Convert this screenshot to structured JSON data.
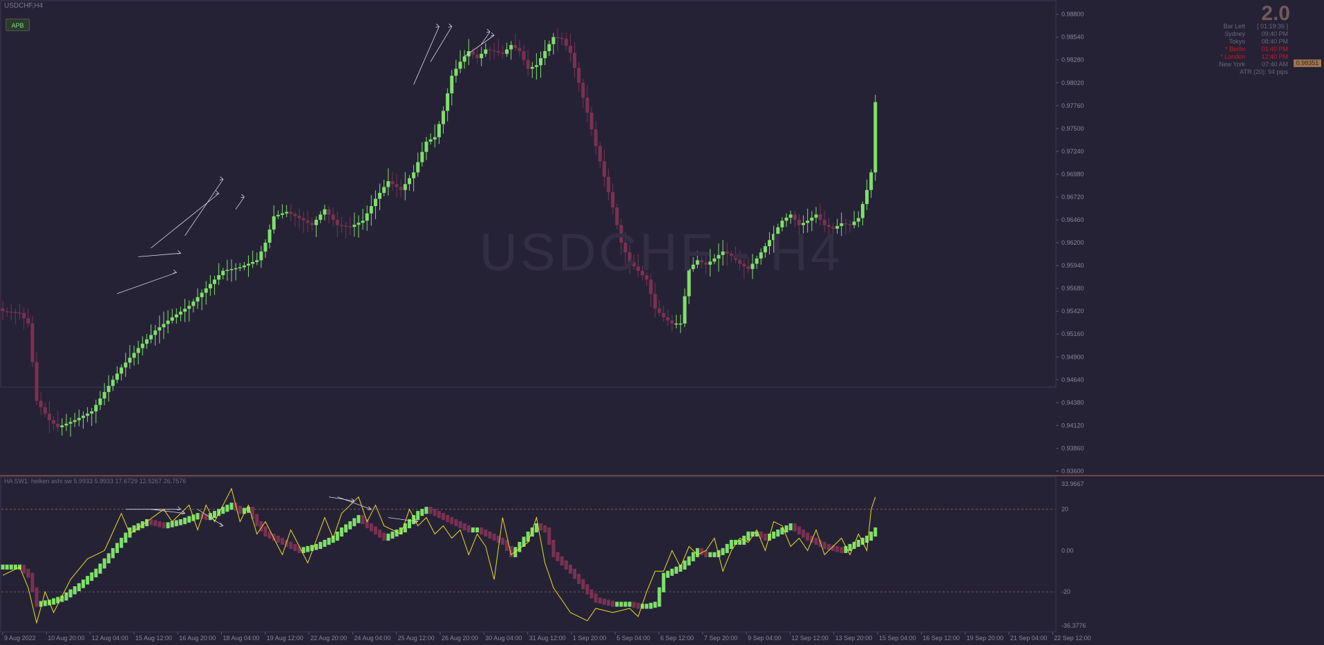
{
  "window": {
    "symbol": "USDCHF,H4",
    "watermark": "USDCHF - H4"
  },
  "toolbar": {
    "apb_label": "APB"
  },
  "version": "2.0",
  "sessions": [
    {
      "label": "Bar Left",
      "value": "[ 01:19:36 ]",
      "active": false
    },
    {
      "label": "Sydney",
      "value": "09:40 PM",
      "active": false
    },
    {
      "label": "Tokyo",
      "value": "08:40 PM",
      "active": false
    },
    {
      "label": "* Berlin",
      "value": "01:40 PM",
      "active": true
    },
    {
      "label": "* London",
      "value": "12:40 PM",
      "active": true
    },
    {
      "label": "New York",
      "value": "07:40 AM",
      "active": false
    }
  ],
  "atr_text": "ATR (20): 94 pips",
  "current_price": "0.98351",
  "colors": {
    "background": "#262236",
    "bull": "#7ee06a",
    "bear": "#7a3152",
    "oscillator_line": "#e8e020",
    "divergence": "#d8d8e8"
  },
  "indicator_label": "HA SW1: heiken ashi sw 5.9933 5.9933 17.6729 12.5267 26.7576",
  "chart_data": [
    {
      "type": "candlestick",
      "title": "USDCHF,H4",
      "y_ticks": [
        "0.98800",
        "0.98540",
        "0.98280",
        "0.98020",
        "0.97760",
        "0.97500",
        "0.97240",
        "0.96980",
        "0.96720",
        "0.96460",
        "0.96200",
        "0.95940",
        "0.95680",
        "0.95420",
        "0.95160",
        "0.94900",
        "0.94640",
        "0.94380",
        "0.94120",
        "0.93860",
        "0.93600"
      ],
      "ylim": [
        0.9358,
        0.9886
      ],
      "x_ticks": [
        "9 Aug 2022",
        "10 Aug 20:00",
        "12 Aug 04:00",
        "15 Aug 12:00",
        "16 Aug 20:00",
        "18 Aug 04:00",
        "19 Aug 12:00",
        "22 Aug 20:00",
        "24 Aug 04:00",
        "25 Aug 12:00",
        "26 Aug 20:00",
        "30 Aug 04:00",
        "31 Aug 12:00",
        "1 Sep 20:00",
        "5 Sep 04:00",
        "6 Sep 12:00",
        "7 Sep 20:00",
        "9 Sep 04:00",
        "12 Sep 12:00",
        "13 Sep 20:00",
        "15 Sep 04:00",
        "16 Sep 12:00",
        "19 Sep 20:00",
        "21 Sep 04:00",
        "22 Sep 12:00"
      ],
      "close_anchors": [
        [
          0,
          0.9542
        ],
        [
          4,
          0.954
        ],
        [
          6,
          0.9528
        ],
        [
          8,
          0.944
        ],
        [
          11,
          0.9418
        ],
        [
          13,
          0.941
        ],
        [
          17,
          0.9418
        ],
        [
          21,
          0.9428
        ],
        [
          24,
          0.945
        ],
        [
          28,
          0.9478
        ],
        [
          32,
          0.95
        ],
        [
          36,
          0.952
        ],
        [
          40,
          0.9535
        ],
        [
          44,
          0.9548
        ],
        [
          48,
          0.9568
        ],
        [
          52,
          0.9588
        ],
        [
          56,
          0.9592
        ],
        [
          60,
          0.96
        ],
        [
          62,
          0.962
        ],
        [
          64,
          0.965
        ],
        [
          67,
          0.9655
        ],
        [
          70,
          0.9648
        ],
        [
          73,
          0.964
        ],
        [
          76,
          0.9658
        ],
        [
          79,
          0.964
        ],
        [
          82,
          0.9638
        ],
        [
          85,
          0.9645
        ],
        [
          88,
          0.967
        ],
        [
          91,
          0.969
        ],
        [
          94,
          0.968
        ],
        [
          97,
          0.97
        ],
        [
          100,
          0.9735
        ],
        [
          102,
          0.974
        ],
        [
          104,
          0.977
        ],
        [
          106,
          0.981
        ],
        [
          108,
          0.9826
        ],
        [
          110,
          0.9838
        ],
        [
          112,
          0.983
        ],
        [
          114,
          0.984
        ],
        [
          116,
          0.9838
        ],
        [
          118,
          0.9835
        ],
        [
          120,
          0.9845
        ],
        [
          122,
          0.9838
        ],
        [
          124,
          0.9818
        ],
        [
          126,
          0.9822
        ],
        [
          128,
          0.9838
        ],
        [
          130,
          0.9854
        ],
        [
          132,
          0.9852
        ],
        [
          134,
          0.9836
        ],
        [
          136,
          0.9802
        ],
        [
          138,
          0.9768
        ],
        [
          140,
          0.973
        ],
        [
          142,
          0.9695
        ],
        [
          144,
          0.966
        ],
        [
          146,
          0.962
        ],
        [
          148,
          0.9598
        ],
        [
          150,
          0.9588
        ],
        [
          152,
          0.9578
        ],
        [
          154,
          0.9545
        ],
        [
          156,
          0.9535
        ],
        [
          158,
          0.9528
        ],
        [
          160,
          0.9528
        ],
        [
          162,
          0.959
        ],
        [
          164,
          0.96
        ],
        [
          166,
          0.9595
        ],
        [
          168,
          0.9602
        ],
        [
          170,
          0.961
        ],
        [
          172,
          0.9605
        ],
        [
          174,
          0.9596
        ],
        [
          176,
          0.959
        ],
        [
          178,
          0.9602
        ],
        [
          180,
          0.9616
        ],
        [
          182,
          0.963
        ],
        [
          184,
          0.9645
        ],
        [
          186,
          0.9652
        ],
        [
          188,
          0.964
        ],
        [
          190,
          0.9645
        ],
        [
          192,
          0.9652
        ],
        [
          194,
          0.964
        ],
        [
          196,
          0.9636
        ],
        [
          198,
          0.9642
        ],
        [
          200,
          0.964
        ],
        [
          202,
          0.9648
        ],
        [
          204,
          0.968
        ],
        [
          205,
          0.97
        ],
        [
          206,
          0.978
        ]
      ],
      "divergence_lines": [
        [
          27,
          0.9562,
          41,
          0.9586
        ],
        [
          32,
          0.9604,
          42,
          0.9608
        ],
        [
          35,
          0.9614,
          51,
          0.9676
        ],
        [
          43,
          0.9628,
          52,
          0.9692
        ],
        [
          55,
          0.9658,
          57,
          0.9672
        ],
        [
          97,
          0.98,
          103,
          0.9866
        ],
        [
          101,
          0.9826,
          106,
          0.9866
        ],
        [
          109,
          0.9832,
          116,
          0.9856
        ],
        [
          113,
          0.9846,
          115,
          0.986
        ]
      ]
    },
    {
      "type": "oscillator",
      "title": "HA SW1: heiken ashi sw 5.9933 5.9933 17.6729 12.5267 26.7576",
      "y_ticks": [
        "33.9667",
        "20",
        "0.00",
        "-20",
        "-36.3776"
      ],
      "ylim": [
        -36.3776,
        33.9667
      ],
      "levels": [
        20,
        -20
      ],
      "value_anchors": [
        [
          0,
          -8
        ],
        [
          4,
          -8
        ],
        [
          6,
          -12
        ],
        [
          8,
          -26
        ],
        [
          11,
          -25
        ],
        [
          14,
          -23
        ],
        [
          18,
          -17
        ],
        [
          22,
          -10
        ],
        [
          26,
          0
        ],
        [
          30,
          10
        ],
        [
          34,
          14
        ],
        [
          38,
          12
        ],
        [
          42,
          14
        ],
        [
          46,
          17
        ],
        [
          48,
          16
        ],
        [
          50,
          18
        ],
        [
          54,
          22
        ],
        [
          56,
          19
        ],
        [
          58,
          20
        ],
        [
          60,
          13
        ],
        [
          62,
          8
        ],
        [
          66,
          4
        ],
        [
          70,
          0
        ],
        [
          74,
          2
        ],
        [
          78,
          6
        ],
        [
          80,
          10
        ],
        [
          84,
          16
        ],
        [
          86,
          12
        ],
        [
          90,
          6
        ],
        [
          94,
          10
        ],
        [
          96,
          14
        ],
        [
          98,
          18
        ],
        [
          100,
          20
        ],
        [
          102,
          18
        ],
        [
          104,
          16
        ],
        [
          106,
          14
        ],
        [
          108,
          12
        ],
        [
          110,
          10
        ],
        [
          112,
          10
        ],
        [
          114,
          8
        ],
        [
          116,
          6
        ],
        [
          118,
          4
        ],
        [
          120,
          -2
        ],
        [
          124,
          8
        ],
        [
          126,
          12
        ],
        [
          128,
          10
        ],
        [
          130,
          -2
        ],
        [
          134,
          -10
        ],
        [
          138,
          -20
        ],
        [
          140,
          -24
        ],
        [
          144,
          -26
        ],
        [
          148,
          -26
        ],
        [
          150,
          -27
        ],
        [
          152,
          -27
        ],
        [
          154,
          -26
        ],
        [
          156,
          -12
        ],
        [
          158,
          -10
        ],
        [
          160,
          -8
        ],
        [
          162,
          -4
        ],
        [
          164,
          0
        ],
        [
          166,
          -2
        ],
        [
          168,
          -2
        ],
        [
          170,
          0
        ],
        [
          172,
          4
        ],
        [
          174,
          4
        ],
        [
          176,
          8
        ],
        [
          178,
          8
        ],
        [
          180,
          6
        ],
        [
          182,
          8
        ],
        [
          184,
          10
        ],
        [
          186,
          12
        ],
        [
          190,
          6
        ],
        [
          194,
          2
        ],
        [
          198,
          0
        ],
        [
          200,
          2
        ],
        [
          204,
          6
        ],
        [
          206,
          10
        ]
      ],
      "line_anchors": [
        [
          0,
          -12
        ],
        [
          4,
          -8
        ],
        [
          6,
          -18
        ],
        [
          8,
          -35
        ],
        [
          10,
          -20
        ],
        [
          12,
          -30
        ],
        [
          16,
          -14
        ],
        [
          20,
          -4
        ],
        [
          24,
          0
        ],
        [
          28,
          18
        ],
        [
          30,
          8
        ],
        [
          34,
          14
        ],
        [
          38,
          20
        ],
        [
          40,
          14
        ],
        [
          44,
          22
        ],
        [
          46,
          10
        ],
        [
          48,
          22
        ],
        [
          50,
          14
        ],
        [
          54,
          30
        ],
        [
          56,
          14
        ],
        [
          58,
          22
        ],
        [
          60,
          8
        ],
        [
          62,
          14
        ],
        [
          66,
          -2
        ],
        [
          68,
          10
        ],
        [
          72,
          -6
        ],
        [
          76,
          16
        ],
        [
          78,
          6
        ],
        [
          80,
          18
        ],
        [
          84,
          26
        ],
        [
          86,
          14
        ],
        [
          88,
          22
        ],
        [
          90,
          12
        ],
        [
          94,
          8
        ],
        [
          96,
          20
        ],
        [
          98,
          12
        ],
        [
          100,
          16
        ],
        [
          102,
          8
        ],
        [
          104,
          12
        ],
        [
          106,
          6
        ],
        [
          108,
          10
        ],
        [
          110,
          -2
        ],
        [
          112,
          8
        ],
        [
          114,
          2
        ],
        [
          116,
          -14
        ],
        [
          118,
          16
        ],
        [
          120,
          -2
        ],
        [
          124,
          4
        ],
        [
          126,
          16
        ],
        [
          128,
          -6
        ],
        [
          130,
          -18
        ],
        [
          134,
          -30
        ],
        [
          138,
          -34
        ],
        [
          140,
          -28
        ],
        [
          144,
          -30
        ],
        [
          148,
          -28
        ],
        [
          150,
          -32
        ],
        [
          152,
          -20
        ],
        [
          154,
          -10
        ],
        [
          156,
          -10
        ],
        [
          158,
          0
        ],
        [
          160,
          -8
        ],
        [
          162,
          2
        ],
        [
          164,
          -2
        ],
        [
          166,
          0
        ],
        [
          168,
          6
        ],
        [
          170,
          -10
        ],
        [
          172,
          0
        ],
        [
          174,
          6
        ],
        [
          176,
          4
        ],
        [
          178,
          10
        ],
        [
          180,
          0
        ],
        [
          182,
          14
        ],
        [
          184,
          12
        ],
        [
          186,
          2
        ],
        [
          188,
          6
        ],
        [
          190,
          0
        ],
        [
          192,
          10
        ],
        [
          194,
          -2
        ],
        [
          196,
          2
        ],
        [
          198,
          6
        ],
        [
          200,
          -2
        ],
        [
          202,
          8
        ],
        [
          204,
          0
        ],
        [
          205,
          20
        ],
        [
          206,
          26
        ]
      ],
      "divergence_lines": [
        [
          29,
          20,
          42,
          20
        ],
        [
          35,
          20,
          43,
          18
        ],
        [
          46,
          20,
          52,
          12
        ],
        [
          77,
          26,
          83,
          24
        ],
        [
          79,
          26,
          87,
          20
        ],
        [
          91,
          16,
          98,
          14
        ]
      ]
    }
  ]
}
